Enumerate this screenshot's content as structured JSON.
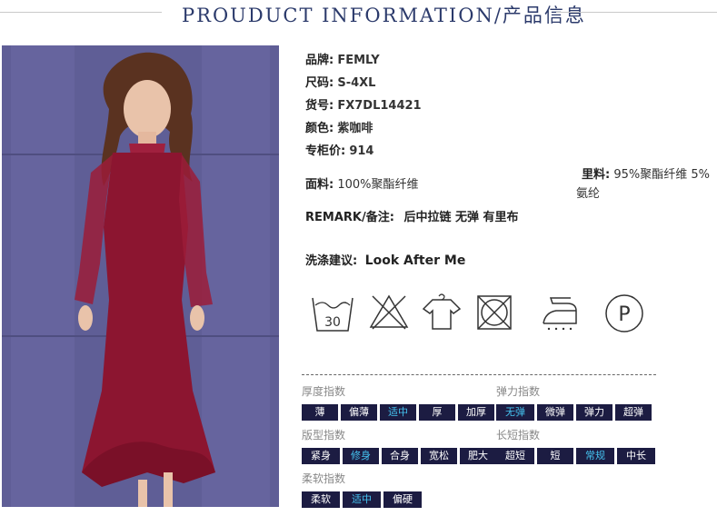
{
  "header": {
    "title": "PROUDUCT INFORMATION/产品信息"
  },
  "product": {
    "brand": {
      "key": "品牌:",
      "value": "FEMLY"
    },
    "size": {
      "key": "尺码:",
      "value": "S-4XL"
    },
    "sku": {
      "key": "货号:",
      "value": "FX7DL14421"
    },
    "color": {
      "key": "颜色:",
      "value": "紫咖啡"
    },
    "price": {
      "key": "专柜价:",
      "value": "914"
    },
    "fabric": {
      "key": "面料:",
      "value": "100%聚酯纤维"
    },
    "lining": {
      "key": "里料:",
      "value": "95%聚酯纤维 5%",
      "value2": "氨纶"
    },
    "remark": {
      "key": "REMARK/备注:",
      "value": "后中拉链 无弹 有里布"
    }
  },
  "care": {
    "title_key": "洗涤建议:",
    "title_value": "Look After Me",
    "wash_temp": "30",
    "icons": [
      "wash-30-icon",
      "no-bleach-icon",
      "hang-dry-icon",
      "no-tumble-dry-icon",
      "low-iron-icon",
      "dry-clean-p-icon"
    ]
  },
  "indices": {
    "thickness": {
      "title": "厚度指数",
      "options": [
        "薄",
        "偏薄",
        "适中",
        "厚",
        "加厚"
      ],
      "selected": "适中"
    },
    "elasticity": {
      "title": "弹力指数",
      "options": [
        "无弹",
        "微弹",
        "弹力",
        "超弹"
      ],
      "selected": "无弹"
    },
    "fit": {
      "title": "版型指数",
      "options": [
        "紧身",
        "修身",
        "合身",
        "宽松",
        "肥大"
      ],
      "selected": "修身"
    },
    "length": {
      "title": "长短指数",
      "options": [
        "超短",
        "短",
        "常规",
        "中长"
      ],
      "selected": "常规"
    },
    "softness": {
      "title": "柔软指数",
      "options": [
        "柔软",
        "适中",
        "偏硬"
      ],
      "selected": "适中"
    }
  },
  "colors": {
    "title": "#2b3a6b",
    "chip_bg": "#1c1c42",
    "chip_selected_text": "#45c3f0",
    "dress": "#8c1530"
  }
}
